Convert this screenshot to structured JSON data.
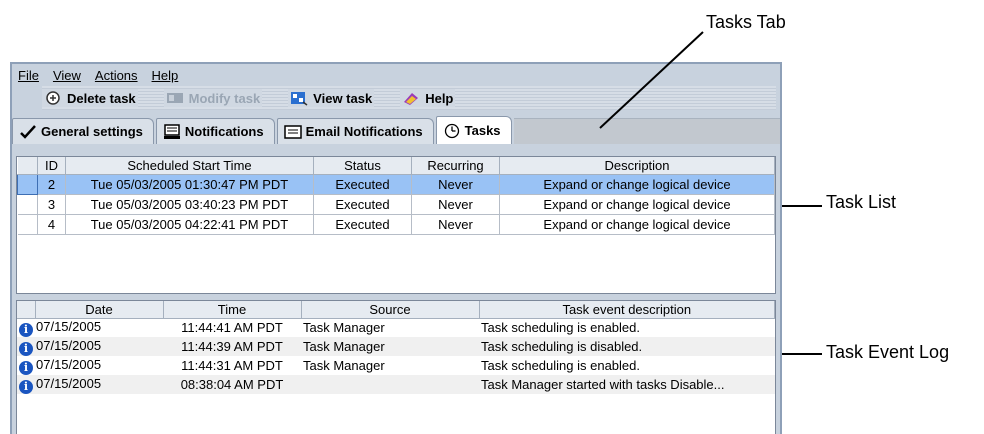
{
  "menubar": {
    "items": [
      {
        "label": "File"
      },
      {
        "label": "View"
      },
      {
        "label": "Actions"
      },
      {
        "label": "Help"
      }
    ]
  },
  "toolbar": {
    "delete_label": "Delete task",
    "modify_label": "Modify task",
    "view_label": "View task",
    "help_label": "Help"
  },
  "tabs": {
    "general": "General settings",
    "notifications": "Notifications",
    "email": "Email Notifications",
    "tasks": "Tasks"
  },
  "task_list": {
    "headers": [
      "ID",
      "Scheduled Start Time",
      "Status",
      "Recurring",
      "Description"
    ],
    "rows": [
      {
        "id": "2",
        "start": "Tue 05/03/2005 01:30:47 PM PDT",
        "status": "Executed",
        "recurring": "Never",
        "description": "Expand or change logical device"
      },
      {
        "id": "3",
        "start": "Tue 05/03/2005 03:40:23 PM PDT",
        "status": "Executed",
        "recurring": "Never",
        "description": "Expand or change logical device"
      },
      {
        "id": "4",
        "start": "Tue 05/03/2005 04:22:41 PM PDT",
        "status": "Executed",
        "recurring": "Never",
        "description": "Expand or change logical device"
      }
    ]
  },
  "event_log": {
    "headers": [
      "Date",
      "Time",
      "Source",
      "Task event description"
    ],
    "rows": [
      {
        "date": "07/15/2005",
        "time": "11:44:41 AM PDT",
        "source": "Task Manager",
        "description": "Task scheduling is enabled."
      },
      {
        "date": "07/15/2005",
        "time": "11:44:39 AM PDT",
        "source": "Task Manager",
        "description": "Task scheduling is disabled."
      },
      {
        "date": "07/15/2005",
        "time": "11:44:31 AM PDT",
        "source": "Task Manager",
        "description": "Task scheduling is enabled."
      },
      {
        "date": "07/15/2005",
        "time": "08:38:04 AM PDT",
        "source": "",
        "description": "Task Manager started with tasks Disable..."
      }
    ]
  },
  "callouts": {
    "tasks_tab": "Tasks Tab",
    "task_list": "Task List",
    "task_event_log": "Task Event Log"
  },
  "colors": {
    "window_bg": "#c8d2de",
    "selection": "#99c2f5",
    "info_icon": "#1a55c0"
  }
}
